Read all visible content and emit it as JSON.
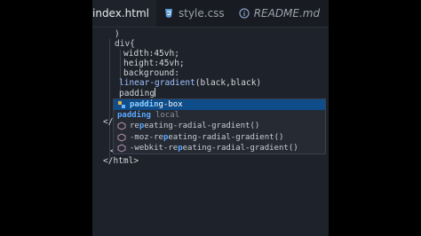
{
  "tabs": [
    {
      "label": "index.html",
      "icon": "html-file-icon",
      "active": true
    },
    {
      "label": "style.css",
      "icon": "css-file-icon",
      "active": false
    },
    {
      "label": "README.md",
      "icon": "markdown-file-icon",
      "active": false
    }
  ],
  "code": {
    "l1": ")",
    "l2_div": "div",
    "l2_brace": "{",
    "l3": "width:45vh;",
    "l4": "height:45vh;",
    "l5": "background:",
    "l6_fn": "linear-gradient",
    "l6_args": "(black,black)",
    "l7": "padding",
    "l_close1": "</",
    "l_close2": "<",
    "l_close3": "</html>",
    "l_partial1": "</h",
    "l_partial2": "<"
  },
  "autocomplete": {
    "items": [
      {
        "match": "paddin",
        "rest": "g-box",
        "detail": "",
        "icon": "property-icon",
        "selected": true
      },
      {
        "match": "padding",
        "rest": "",
        "detail": "local",
        "icon": "none",
        "selected": false
      },
      {
        "prefix": "re",
        "match": "p",
        "rest": "eating-radial-gradient()",
        "detail": "",
        "icon": "function-icon",
        "selected": false
      },
      {
        "prefix": "-moz-re",
        "match": "p",
        "rest": "eating-radial-gradient()",
        "detail": "",
        "icon": "function-icon",
        "selected": false
      },
      {
        "prefix": "-webkit-re",
        "match": "p",
        "rest": "eating-radial-gradient()",
        "detail": "",
        "icon": "function-icon",
        "selected": false
      }
    ]
  },
  "colors": {
    "editor_bg": "#1e222a",
    "selected_bg": "#0f4c8a",
    "match": "#5aa9ff"
  }
}
